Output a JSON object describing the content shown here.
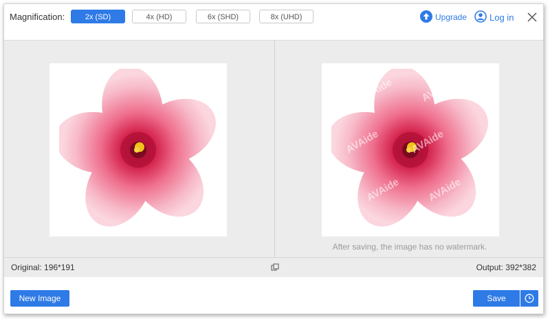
{
  "toolbar": {
    "magnification_label": "Magnification:",
    "options": [
      "2x (SD)",
      "4x (HD)",
      "6x (SHD)",
      "8x (UHD)"
    ],
    "selected": "2x (SD)",
    "upgrade_label": "Upgrade",
    "login_label": "Log in"
  },
  "preview": {
    "watermark_text": "AVAide",
    "note": "After saving, the image has no watermark."
  },
  "info": {
    "original": "Original: 196*191",
    "output": "Output: 392*382"
  },
  "actions": {
    "new_image_label": "New Image",
    "save_label": "Save"
  },
  "colors": {
    "accent": "#2e7ae6",
    "panel_bg": "#ececec"
  },
  "icons": [
    "upgrade-icon",
    "user-icon",
    "close-icon",
    "compare-icon",
    "history-icon"
  ]
}
